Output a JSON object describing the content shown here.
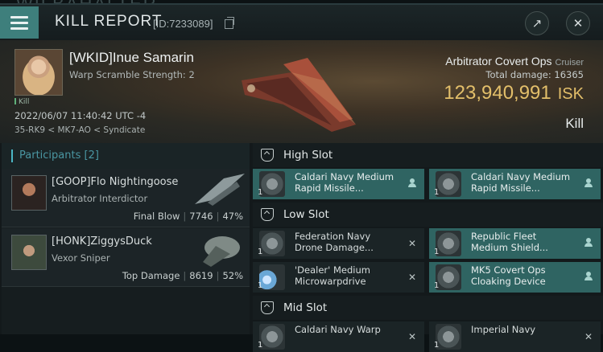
{
  "background_text": "WILBAHALTER",
  "header": {
    "title": "KILL REPORT",
    "kill_id": "[ID:7233089]"
  },
  "victim": {
    "name": "[WKID]Inue Samarin",
    "warp_scramble": "Warp Scramble Strength: 2",
    "kill_tag": "Kill",
    "datetime": "2022/06/07 11:40:42 UTC -4",
    "location": "35-RK9 < MK7-AO < Syndicate",
    "ship_name": "Arbitrator Covert Ops",
    "ship_class": "Cruiser",
    "total_damage": "Total damage: 16365",
    "isk_value": "123,940,991",
    "isk_unit": "ISK",
    "result": "Kill"
  },
  "participants": {
    "title": "Participants [2]",
    "rows": [
      {
        "name": "[GOOP]Flo Nightingoose",
        "ship": "Arbitrator Interdictor",
        "role": "Final Blow",
        "damage": "7746",
        "percent": "47%"
      },
      {
        "name": "[HONK]ZiggysDuck",
        "ship": "Vexor Sniper",
        "role": "Top Damage",
        "damage": "8619",
        "percent": "52%"
      }
    ]
  },
  "slots": {
    "high": {
      "title": "High Slot",
      "modules": [
        {
          "name": "Caldari Navy Medium Rapid Missile...",
          "qty": "1"
        },
        {
          "name": "Caldari Navy Medium Rapid Missile...",
          "qty": "1"
        }
      ]
    },
    "low": {
      "title": "Low Slot",
      "modules": [
        {
          "name": "Federation Navy Drone Damage...",
          "qty": "1"
        },
        {
          "name": "Republic Fleet Medium Shield...",
          "qty": "1"
        },
        {
          "name": "'Dealer' Medium Microwarpdrive",
          "qty": "1"
        },
        {
          "name": "MK5 Covert Ops Cloaking Device",
          "qty": "1"
        }
      ]
    },
    "mid": {
      "title": "Mid Slot",
      "modules": [
        {
          "name": "Caldari Navy Warp",
          "qty": "1"
        },
        {
          "name": "Imperial Navy",
          "qty": "1"
        }
      ]
    }
  },
  "colors": {
    "accent": "#3e7f7c",
    "isk": "#e3bf6a",
    "highlight": "#2f6462"
  }
}
